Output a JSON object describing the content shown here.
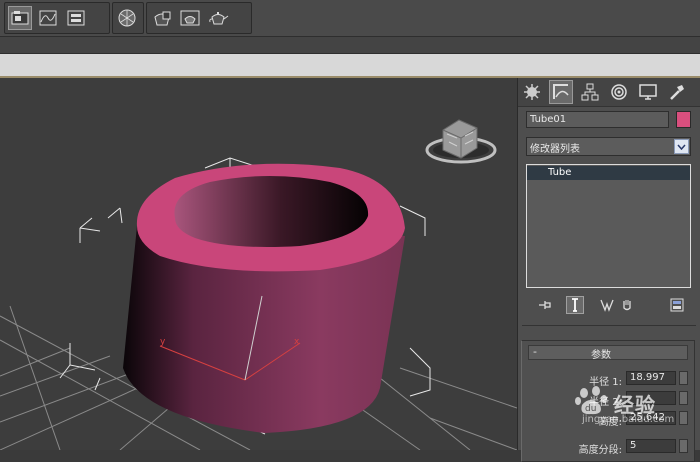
{
  "toolbar": {
    "buttons": [
      "open-explorer",
      "curve-editor",
      "schematic-view",
      "material-editor",
      "render-setup",
      "rendered-frame",
      "render"
    ]
  },
  "viewport": {
    "object_color": "#d94f7e",
    "axis_labels": {
      "y": "y",
      "x": "x"
    }
  },
  "command_panel": {
    "tabs": [
      "create",
      "modify",
      "hierarchy",
      "motion",
      "display",
      "utilities"
    ],
    "object_name": "Tube01",
    "object_color": "#d94f7e",
    "modifier_list_label": "修改器列表",
    "stack_items": [
      {
        "label": "Tube"
      }
    ],
    "parameters_rollout": {
      "title": "参数",
      "params": [
        {
          "label": "半径 1:",
          "value": "18.997"
        },
        {
          "label": "半径 2:",
          "value": ""
        },
        {
          "label": "高度:",
          "value": "25.642"
        },
        {
          "label": "高度分段:",
          "value": "5"
        }
      ]
    }
  },
  "watermark": {
    "text": "经验",
    "url": "jingyan.baidu.com"
  }
}
